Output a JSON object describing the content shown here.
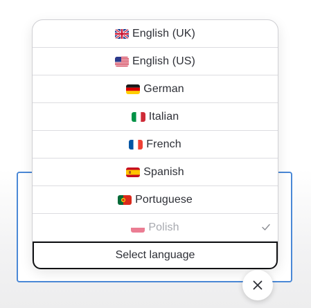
{
  "language_menu": {
    "options": [
      {
        "label": "English (UK)",
        "flag": "uk-flag-icon",
        "selected": false
      },
      {
        "label": "English (US)",
        "flag": "us-flag-icon",
        "selected": false
      },
      {
        "label": "German",
        "flag": "germany-flag-icon",
        "selected": false
      },
      {
        "label": "Italian",
        "flag": "italy-flag-icon",
        "selected": false
      },
      {
        "label": "French",
        "flag": "france-flag-icon",
        "selected": false
      },
      {
        "label": "Spanish",
        "flag": "spain-flag-icon",
        "selected": false
      },
      {
        "label": "Portuguese",
        "flag": "portugal-flag-icon",
        "selected": false
      },
      {
        "label": "Polish",
        "flag": "poland-flag-icon",
        "selected": true
      }
    ],
    "select_label": "Select language"
  },
  "icons": {
    "selected_mark": "check-icon",
    "close": "close-icon"
  },
  "colors": {
    "backdrop_border": "#4a88d6",
    "trigger_border": "#111214",
    "text": "#2d2f36",
    "muted_text": "#a7a9af"
  }
}
